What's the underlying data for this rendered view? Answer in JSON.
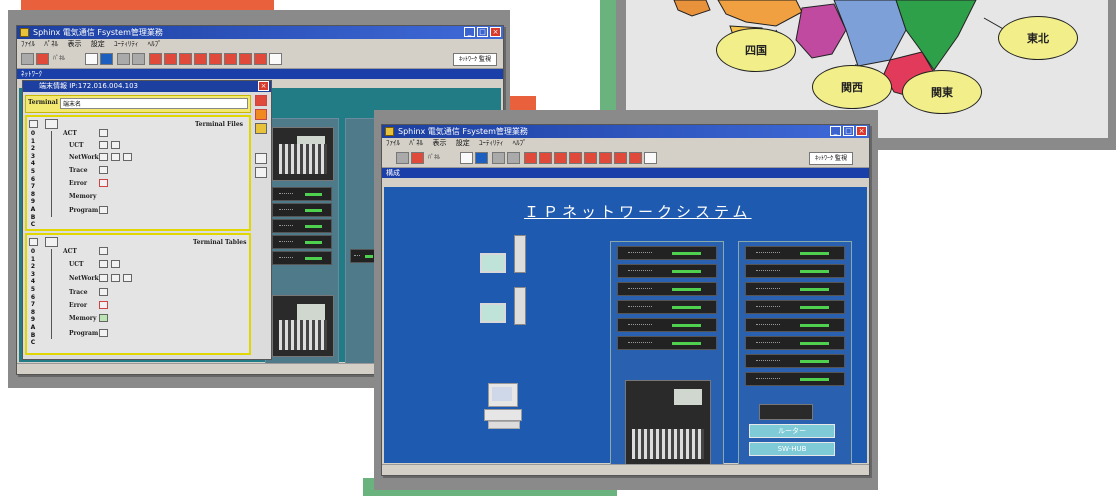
{
  "colors": {
    "orange_accent": "#e8603c",
    "green_accent": "#6ab27e",
    "frame_gray": "#8a8a8a",
    "title_blue": "#1c3fa0",
    "teal_canvas": "#217c86",
    "blue_canvas": "#1e5ab0",
    "map_bubble": "#f2ef8a"
  },
  "left_window": {
    "title": "Sphinx 電気通信 Fsystem管理業務",
    "menu": [
      "ﾌｧｲﾙ",
      "ﾊﾟﾈﾙ",
      "表示",
      "設定",
      "ﾕｰﾃｨﾘﾃｨ",
      "ﾍﾙﾌﾟ"
    ],
    "toolbar_label": "ﾊﾟﾈﾙ",
    "select_value": "ﾈｯﾄﾜｰｸ 監視",
    "subhead": "ﾈｯﾄﾜｰｸ",
    "terminal_window": {
      "title": "端末情報 IP:172.016.004.103",
      "terminal_label": "Terminal",
      "terminal_value": "端末名",
      "panel1": {
        "header": "Terminal Files",
        "items": [
          "ACT",
          "UCT",
          "NetWork",
          "Trace",
          "Error",
          "Memory",
          "Program"
        ]
      },
      "panel2": {
        "header": "Terminal Tables",
        "items": [
          "ACT",
          "UCT",
          "NetWork",
          "Trace",
          "Error",
          "Memory",
          "Program"
        ]
      },
      "digits": [
        "0",
        "1",
        "2",
        "3",
        "4",
        "5",
        "6",
        "7",
        "8",
        "9",
        "A",
        "B",
        "C"
      ]
    }
  },
  "map": {
    "regions": [
      "四国",
      "関西",
      "関東",
      "東北"
    ]
  },
  "center_window": {
    "title": "Sphinx 電気通信 Fsystem管理業務",
    "menu": [
      "ﾌｧｲﾙ",
      "ﾊﾟﾈﾙ",
      "表示",
      "設定",
      "ﾕｰﾃｨﾘﾃｨ",
      "ﾍﾙﾌﾟ"
    ],
    "toolbar_label": "ﾊﾟﾈﾙ",
    "select_value": "ﾈｯﾄﾜｰｸ 監視",
    "subhead": "構成",
    "canvas_title": "ＩＰネットワークシステム",
    "router_label": "ルーター",
    "hub_label": "SW-HUB"
  }
}
